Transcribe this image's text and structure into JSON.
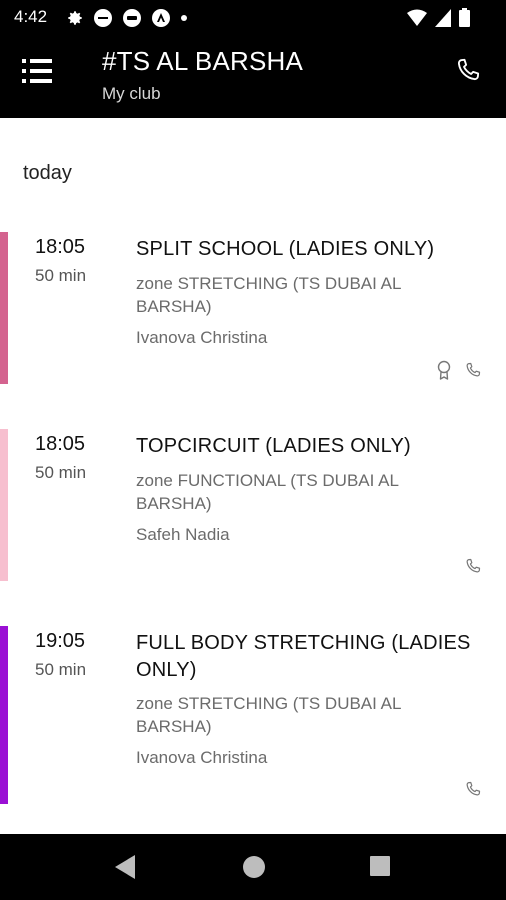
{
  "status_bar": {
    "time": "4:42"
  },
  "app_bar": {
    "title": "#TS AL BARSHA",
    "subtitle": "My club"
  },
  "schedule": {
    "day_label": "today",
    "sessions": [
      {
        "time": "18:05",
        "duration": "50 min",
        "name": "SPLIT SCHOOL (LADIES ONLY)",
        "zone": "zone STRETCHING (TS DUBAI AL BARSHA)",
        "trainer": "Ivanova Christina",
        "color": "#d4638f",
        "icons": [
          "award-icon",
          "phone-icon"
        ]
      },
      {
        "time": "18:05",
        "duration": "50 min",
        "name": "TOPCIRCUIT (LADIES ONLY)",
        "zone": "zone FUNCTIONAL (TS DUBAI AL BARSHA)",
        "trainer": "Safeh Nadia",
        "color": "#f7bfcf",
        "icons": [
          "phone-icon"
        ]
      },
      {
        "time": "19:05",
        "duration": "50 min",
        "name": "FULL BODY STRETCHING (LADIES ONLY)",
        "zone": "zone STRETCHING (TS DUBAI AL BARSHA)",
        "trainer": "Ivanova Christina",
        "color": "#9a10d4",
        "icons": [
          "phone-icon"
        ]
      }
    ]
  },
  "colors": {
    "app_bar_bg": "#000000",
    "content_bg": "#ffffff",
    "secondary_text": "#6b6b6b"
  }
}
